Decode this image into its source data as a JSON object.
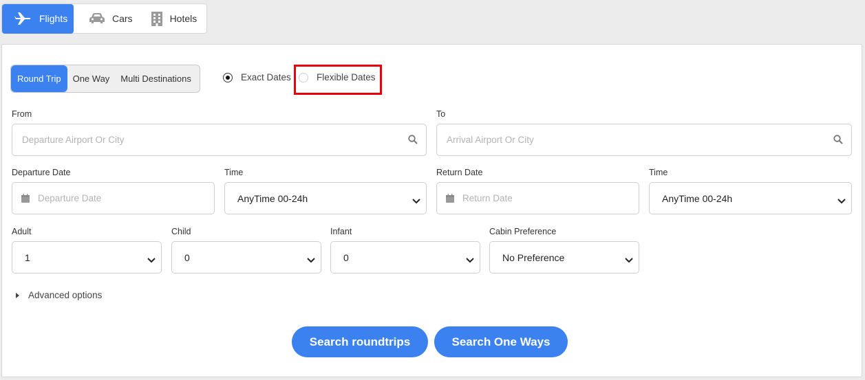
{
  "tabs": [
    {
      "label": "Flights",
      "icon": "airplane-icon",
      "active": true
    },
    {
      "label": "Cars",
      "icon": "car-icon",
      "active": false
    },
    {
      "label": "Hotels",
      "icon": "building-icon",
      "active": false
    }
  ],
  "trip_types": [
    "Round Trip",
    "One Way",
    "Multi Destinations"
  ],
  "date_mode": {
    "exact": "Exact Dates",
    "flexible": "Flexible Dates",
    "selected": "Exact Dates"
  },
  "form": {
    "from": {
      "label": "From",
      "placeholder": "Departure Airport Or City"
    },
    "to": {
      "label": "To",
      "placeholder": "Arrival Airport Or City"
    },
    "departure_date": {
      "label": "Departure Date",
      "placeholder": "Departure Date"
    },
    "departure_time": {
      "label": "Time",
      "value": "AnyTime 00-24h"
    },
    "return_date": {
      "label": "Return Date",
      "placeholder": "Return Date"
    },
    "return_time": {
      "label": "Time",
      "value": "AnyTime 00-24h"
    },
    "adult": {
      "label": "Adult",
      "value": "1"
    },
    "child": {
      "label": "Child",
      "value": "0"
    },
    "infant": {
      "label": "Infant",
      "value": "0"
    },
    "cabin": {
      "label": "Cabin Preference",
      "value": "No Preference"
    }
  },
  "advanced_label": "Advanced options",
  "buttons": {
    "roundtrips": "Search roundtrips",
    "oneways": "Search One Ways"
  },
  "colors": {
    "accent": "#3b82f0",
    "highlight": "#e8000b"
  }
}
